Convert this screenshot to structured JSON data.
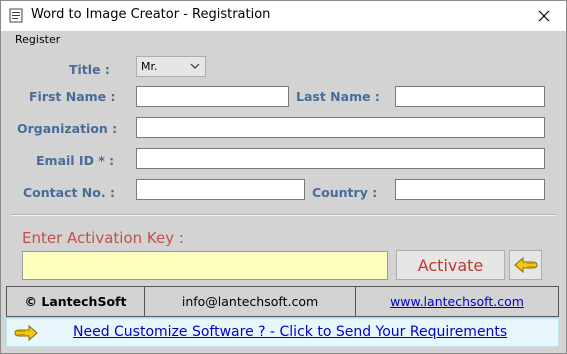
{
  "window": {
    "title": "Word to Image Creator - Registration",
    "close_glyph": "✕"
  },
  "form": {
    "group_label": "Register",
    "title_label": "Title :",
    "title_value": "Mr.",
    "first_name_label": "First Name :",
    "first_name_value": "",
    "last_name_label": "Last Name :",
    "last_name_value": "",
    "organization_label": "Organization :",
    "organization_value": "",
    "email_label": "Email ID * :",
    "email_value": "",
    "contact_label": "Contact No. :",
    "contact_value": "",
    "country_label": "Country :",
    "country_value": ""
  },
  "activation": {
    "label": "Enter Activation Key  :",
    "key_value": "",
    "activate_button": "Activate",
    "back_icon": "hand-pointing-left-icon"
  },
  "footer": {
    "copyright": "© LantechSoft",
    "email": "info@lantechsoft.com",
    "website": "www.lantechsoft.com"
  },
  "banner": {
    "icon": "hand-pointing-right-icon",
    "link_text": "Need Customize Software ? - Click to Send Your Requirements"
  },
  "colors": {
    "label_blue": "#4a6b9a",
    "activation_red": "#c0504d",
    "key_field_bg": "#ffffc0",
    "banner_bg": "#e8f7fb",
    "link_blue": "#0000cc"
  }
}
